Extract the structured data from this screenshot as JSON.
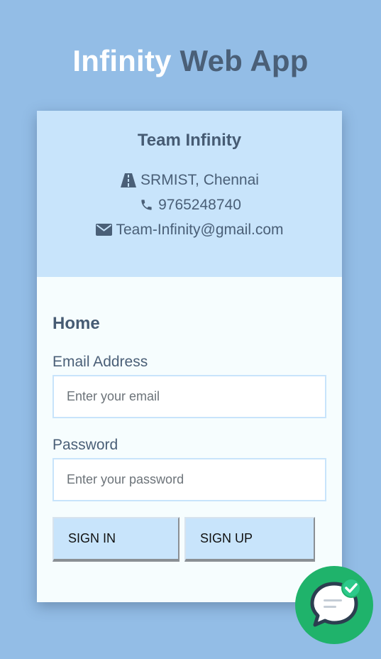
{
  "header": {
    "title_part1": "Infinity",
    "title_part2": "Web App"
  },
  "team": {
    "name": "Team Infinity",
    "location": "SRMIST, Chennai",
    "phone": "9765248740",
    "email": "Team-Infinity@gmail.com"
  },
  "form": {
    "title": "Home",
    "email_label": "Email Address",
    "email_placeholder": "Enter your email",
    "email_value": "",
    "password_label": "Password",
    "password_placeholder": "Enter your password",
    "password_value": "",
    "sign_in_label": "SIGN IN",
    "sign_up_label": "SIGN UP"
  },
  "icons": {
    "location": "road-icon",
    "phone": "phone-icon",
    "email": "envelope-icon",
    "chat": "chat-bubble-icon"
  },
  "colors": {
    "background": "#93bde6",
    "card_header": "#c8e4fb",
    "card_body": "#f6fdfe",
    "text_dark": "#4a5f77",
    "chat_fab": "#1fb36b"
  }
}
